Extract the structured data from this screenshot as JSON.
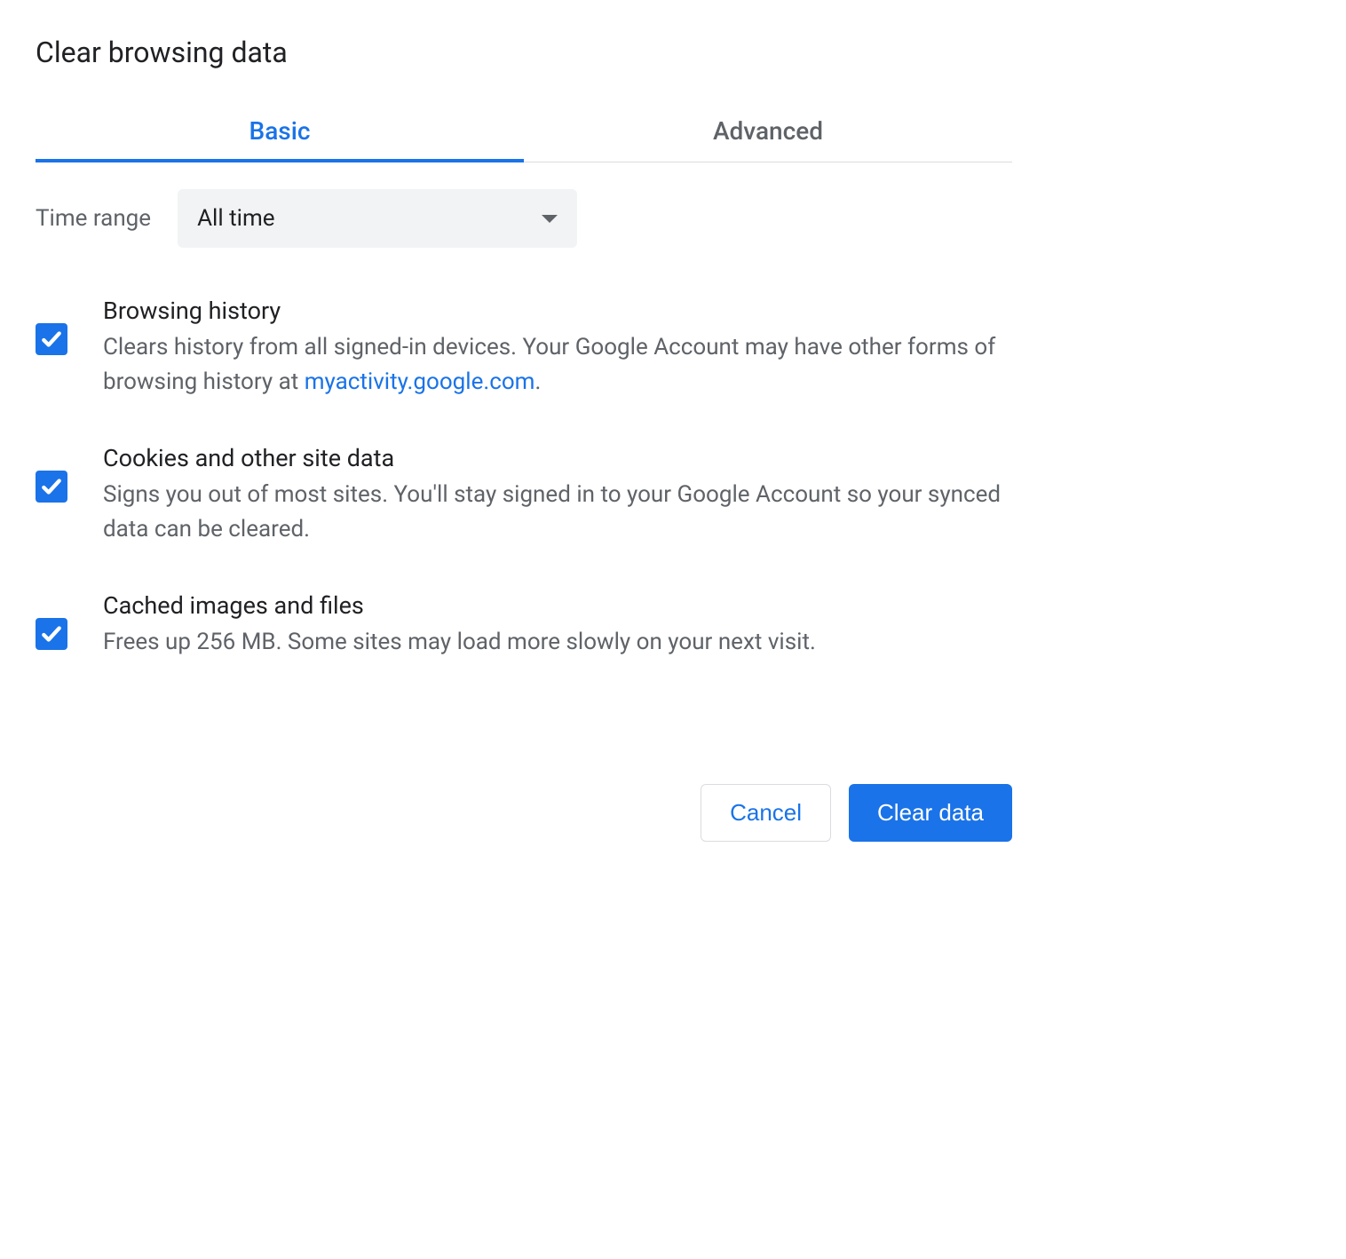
{
  "dialog": {
    "title": "Clear browsing data"
  },
  "tabs": {
    "basic": "Basic",
    "advanced": "Advanced"
  },
  "timeRange": {
    "label": "Time range",
    "value": "All time"
  },
  "options": {
    "browsingHistory": {
      "title": "Browsing history",
      "descPrefix": "Clears history from all signed-in devices. Your Google Account may have other forms of browsing history at ",
      "link": "myactivity.google.com",
      "descSuffix": "."
    },
    "cookies": {
      "title": "Cookies and other site data",
      "desc": "Signs you out of most sites. You'll stay signed in to your Google Account so your synced data can be cleared."
    },
    "cache": {
      "title": "Cached images and files",
      "desc": "Frees up 256 MB. Some sites may load more slowly on your next visit."
    }
  },
  "buttons": {
    "cancel": "Cancel",
    "clearData": "Clear data"
  }
}
